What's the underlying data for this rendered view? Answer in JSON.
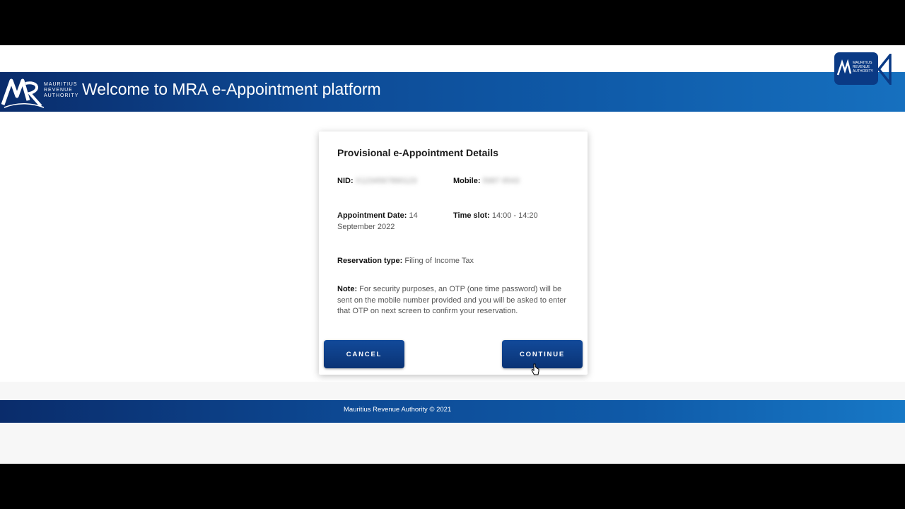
{
  "header": {
    "title": "Welcome to MRA e-Appointment platform",
    "logo_lines": [
      "MAURITIUS",
      "REVENUE",
      "AUTHORITY"
    ]
  },
  "card": {
    "title": "Provisional e-Appointment Details",
    "nid": {
      "label": "NID:",
      "value": "X1234567890123"
    },
    "mobile": {
      "label": "Mobile:",
      "value": "5987 6543"
    },
    "appointment_date": {
      "label": "Appointment Date:",
      "value": "14 September 2022"
    },
    "time_slot": {
      "label": "Time slot:",
      "value": "14:00 - 14:20"
    },
    "reservation_type": {
      "label": "Reservation type:",
      "value": "Filing of Income Tax"
    },
    "note": {
      "label": "Note:",
      "text": "For security purposes, an OTP (one time password) will be sent on the mobile number provided and you will be asked to enter that OTP on next screen to confirm your reservation."
    },
    "buttons": {
      "cancel": "CANCEL",
      "continue": "CONTINUE"
    }
  },
  "footer": {
    "text": "Mauritius Revenue Authority © 2021"
  },
  "colors": {
    "brand_dark": "#0a2c6b",
    "brand_light": "#1670bf",
    "button": "#0a3375"
  },
  "icons": {
    "logo": "mra-logo-icon",
    "badge": "mra-badge-icon",
    "cursor": "hand-cursor-icon"
  }
}
